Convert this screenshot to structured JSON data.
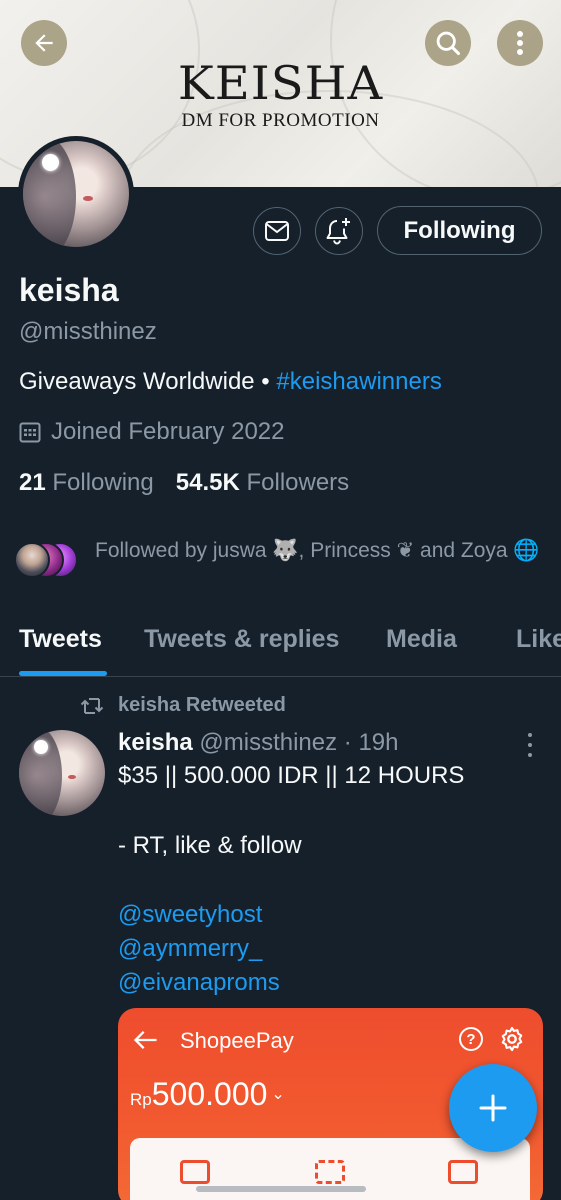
{
  "banner": {
    "brand_name": "KEISHA",
    "brand_tagline": "DM FOR PROMOTION"
  },
  "nav": {
    "back_icon": "back-arrow-icon",
    "search_icon": "search-icon",
    "more_icon": "more-vertical-icon"
  },
  "profile": {
    "display_name": "keisha",
    "handle": "@missthinez",
    "bio_text": "Giveaways Worldwide • ",
    "bio_hashtag": "#keishawinners",
    "joined": "Joined February 2022",
    "following_count": "21",
    "following_label": "Following",
    "followers_count": "54.5K",
    "followers_label": "Followers",
    "followed_by": "Followed by juswa 🐺, Princess ❦ and Zoya 🌐",
    "following_button": "Following"
  },
  "tabs": [
    {
      "label": "Tweets",
      "active": true
    },
    {
      "label": "Tweets & replies",
      "active": false
    },
    {
      "label": "Media",
      "active": false
    },
    {
      "label": "Likes",
      "active": false
    }
  ],
  "tweet": {
    "retweet_label": "keisha Retweeted",
    "author_name": "keisha",
    "author_meta": "@missthinez · 19h",
    "lines": [
      "$35 || 500.000 IDR || 12 HOURS",
      "- RT, like & follow"
    ],
    "mentions": [
      "@sweetyhost",
      "@aymmerry_",
      "@eivanaproms"
    ],
    "media": {
      "app_title": "ShopeePay",
      "currency": "Rp",
      "amount": "500.000",
      "help": "?"
    }
  },
  "colors": {
    "background": "#15202b",
    "accent": "#1d9bf0",
    "muted": "#8b98a5",
    "shopee": "#ee4d2d"
  }
}
